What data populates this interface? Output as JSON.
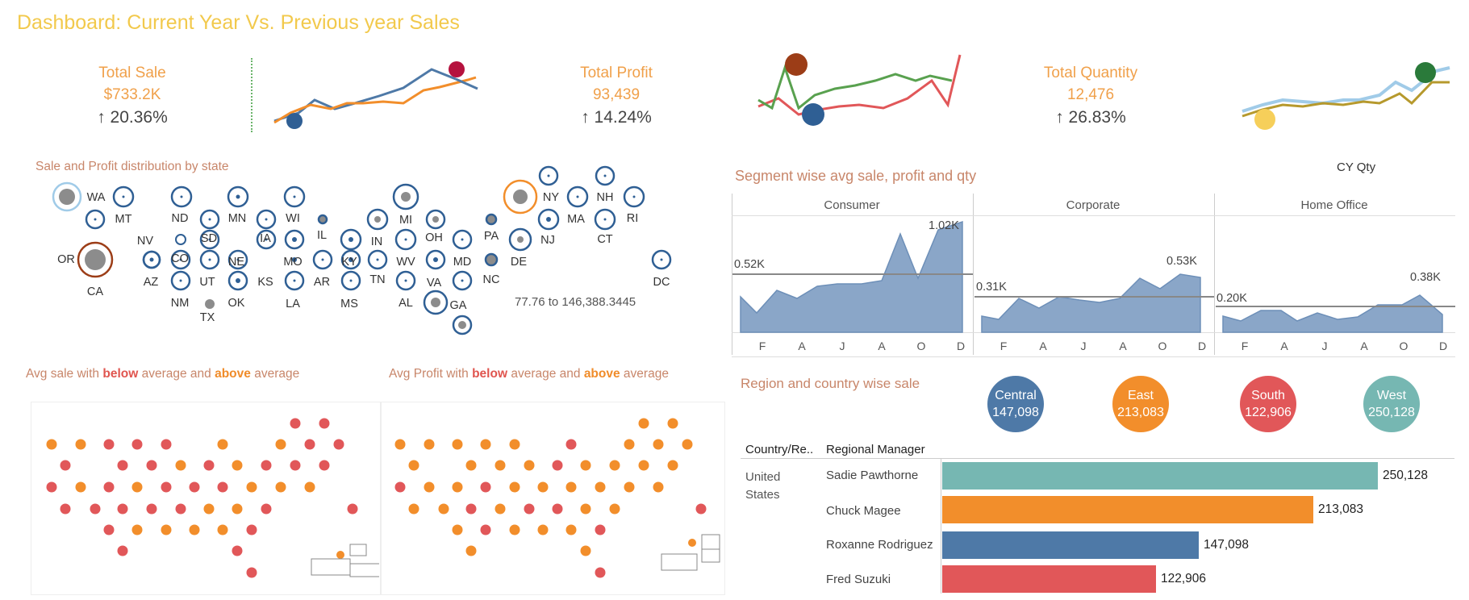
{
  "dashboard": {
    "title": "Dashboard: Current Year  Vs. Previous year Sales"
  },
  "kpis": {
    "sale": {
      "label": "Total Sale",
      "value": "$733.2K",
      "change": "↑ 20.36%"
    },
    "profit": {
      "label": "Total Profit",
      "value": "93,439",
      "change": "↑ 14.24%"
    },
    "quantity": {
      "label": "Total Quantity",
      "value": "12,476",
      "change": "↑ 26.83%"
    }
  },
  "colors": {
    "blue": "#4e79a7",
    "orange": "#f28e2b",
    "red": "#e15759",
    "teal": "#76b7b2",
    "green": "#59a14f",
    "light_blue": "#a0cbe8",
    "olive": "#b6992d",
    "crimson": "#b5123e",
    "brown": "#9c3d17",
    "yellow": "#f6cf5a",
    "grey": "#8c8c8c"
  },
  "state_map": {
    "title": "Sale and Profit distribution by state",
    "range_text": "77.76 to 146,388.3445",
    "states": [
      "WA",
      "MT",
      "ND",
      "MN",
      "WI",
      "MI",
      "NY",
      "NH",
      "OR",
      "NV",
      "SD",
      "IA",
      "IL",
      "OH",
      "PA",
      "MA",
      "RI",
      "CA",
      "CO",
      "NE",
      "MO",
      "IN",
      "WV",
      "MD",
      "NJ",
      "CT",
      "AZ",
      "UT",
      "KS",
      "AR",
      "KY",
      "TN",
      "VA",
      "DE",
      "DC",
      "NM",
      "OK",
      "LA",
      "MS",
      "AL",
      "GA",
      "NC",
      "TX"
    ]
  },
  "segment": {
    "title": "Segment wise avg sale, profit and qty",
    "legend": "CY Qty",
    "panels": [
      {
        "name": "Consumer",
        "avg": "0.52K",
        "max": "1.02K"
      },
      {
        "name": "Corporate",
        "avg": "0.31K",
        "max": "0.53K"
      },
      {
        "name": "Home Office",
        "avg": "0.20K",
        "max": "0.38K"
      }
    ],
    "months": [
      "F",
      "A",
      "J",
      "A",
      "O",
      "D"
    ]
  },
  "avg_sale_map": {
    "prefix": "Avg sale with ",
    "below": "below",
    "mid": " average and ",
    "above": "above",
    "suffix": " average"
  },
  "avg_profit_map": {
    "prefix": "Avg Profit with ",
    "below": "below",
    "mid": " average and ",
    "above": "above",
    "suffix": " average"
  },
  "region": {
    "title": "Region and country wise sale",
    "regions": [
      {
        "name": "Central",
        "value": "147,098"
      },
      {
        "name": "East",
        "value": "213,083"
      },
      {
        "name": "South",
        "value": "122,906"
      },
      {
        "name": "West",
        "value": "250,128"
      }
    ]
  },
  "manager_table": {
    "col1": "Country/Re..",
    "col2": "Regional Manager",
    "country": "United\nStates",
    "rows": [
      {
        "manager": "Sadie Pawthorne",
        "value": 250128,
        "label": "250,128"
      },
      {
        "manager": "Chuck Magee",
        "value": 213083,
        "label": "213,083"
      },
      {
        "manager": "Roxanne Rodriguez",
        "value": 147098,
        "label": "147,098"
      },
      {
        "manager": "Fred Suzuki",
        "value": 122906,
        "label": "122,906"
      }
    ]
  }
}
